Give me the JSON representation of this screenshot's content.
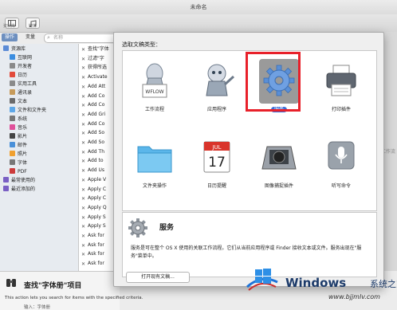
{
  "window": {
    "title": "未命名"
  },
  "toolbar": {
    "library_label": "资料库",
    "media_label": "媒体"
  },
  "left_tabs": {
    "actions": "操作",
    "variables": "变量"
  },
  "search": {
    "placeholder": "名称"
  },
  "library": {
    "items": [
      {
        "label": "资源库",
        "color": "#5b8bd6"
      },
      {
        "label": "互联网",
        "color": "#3b8de0"
      },
      {
        "label": "开发者",
        "color": "#8a8a8a"
      },
      {
        "label": "日历",
        "color": "#e24a3b"
      },
      {
        "label": "实用工具",
        "color": "#8a8a8a"
      },
      {
        "label": "通讯录",
        "color": "#c79b5a"
      },
      {
        "label": "文本",
        "color": "#6b6b6b"
      },
      {
        "label": "文件和文件夹",
        "color": "#5fa8e8"
      },
      {
        "label": "系统",
        "color": "#777777"
      },
      {
        "label": "音乐",
        "color": "#e0509a"
      },
      {
        "label": "影片",
        "color": "#444444"
      },
      {
        "label": "邮件",
        "color": "#4a90d9"
      },
      {
        "label": "照片",
        "color": "#f0a030"
      },
      {
        "label": "字体",
        "color": "#777777"
      },
      {
        "label": "PDF",
        "color": "#cc3b3b"
      },
      {
        "label": "最常使用的",
        "color": "#7a5fc4"
      },
      {
        "label": "最近添加的",
        "color": "#7a5fc4"
      }
    ]
  },
  "actions": {
    "items": [
      "查找\"字体",
      "过滤\"字",
      "获得所选",
      "Activate",
      "Add Att",
      "Add Co",
      "Add Co",
      "Add Gri",
      "Add Co",
      "Add So",
      "Add So",
      "Add Th",
      "Add to",
      "Add Us",
      "Apple V",
      "Apply C",
      "Apply C",
      "Apply Q",
      "Apply S",
      "Apply S",
      "Ask for",
      "Ask for",
      "Ask for",
      "Ask for"
    ]
  },
  "dialog": {
    "heading": "选取文稿类型：",
    "types": [
      {
        "label": "工作流程",
        "icon": "workflow-icon"
      },
      {
        "label": "应用程序",
        "icon": "robot-icon"
      },
      {
        "label": "服务",
        "icon": "gear-icon",
        "selected": true
      },
      {
        "label": "打印插件",
        "icon": "printer-icon"
      },
      {
        "label": "文件夹操作",
        "icon": "folder-icon"
      },
      {
        "label": "日历提醒",
        "icon": "calendar-icon"
      },
      {
        "label": "图像捕捉插件",
        "icon": "camera-icon"
      },
      {
        "label": "听写命令",
        "icon": "microphone-icon"
      }
    ],
    "workflow_badge": "WFLOW",
    "calendar": {
      "month": "JUL",
      "day": "17"
    },
    "selected_title": "服务",
    "selected_desc": "服务是可在整个 OS X 使用的关联工作流程。它们从当前应用程序或 Finder 接收文本或文件。服务出现在\"服务\"菜单中。",
    "open_button": "打开现有文稿..."
  },
  "workflow_hint": "工作流",
  "info_panel": {
    "title": "查找\"字体册\"项目",
    "desc": "This action lets you search for items with the specified criteria.",
    "more": "输入：字体册"
  },
  "watermark": {
    "brand": "Windows",
    "sub": "系统之家",
    "url": "www.bjjmlv.com"
  }
}
